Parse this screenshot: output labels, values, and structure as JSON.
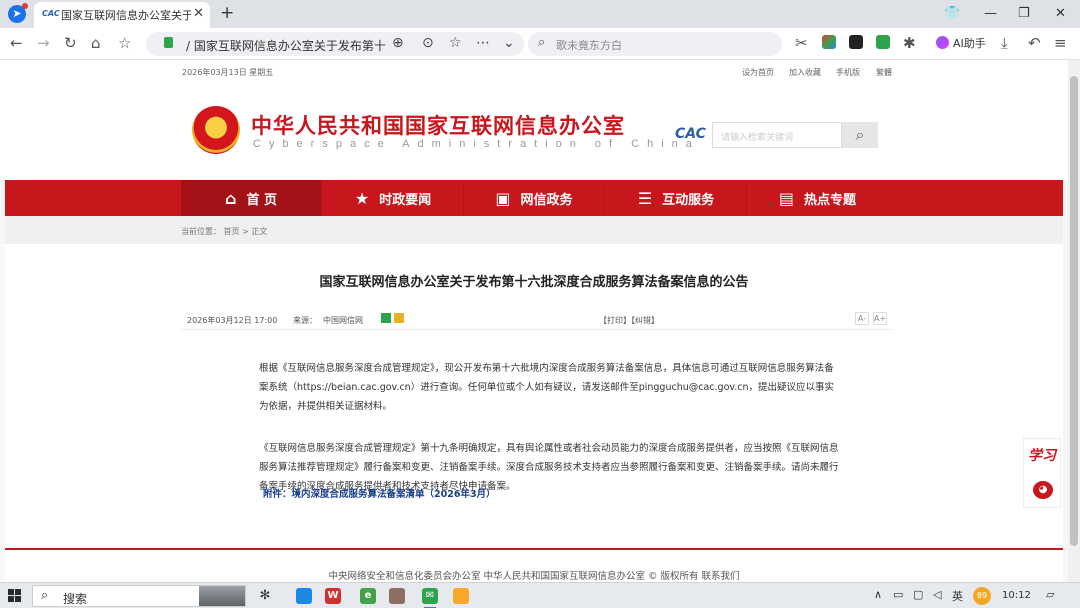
{
  "browser": {
    "tab_title": "国家互联网信息办公室关于发",
    "tab_favicon": "CAC",
    "address_text": "/ 国家互联网信息办公室关于发布第十",
    "search_placeholder": "歌未竟东方白",
    "ai_helper_label": "AI助手"
  },
  "page": {
    "top": {
      "date": "2026年03月13日 星期五",
      "links": [
        "设为首页",
        "加入收藏",
        "手机版",
        "繁體"
      ]
    },
    "header": {
      "title": "中华人民共和国国家互联网信息办公室",
      "subtitle": "Cyberspace Administration of China",
      "logo_text": "CAC",
      "search_placeholder": "请输入检索关键词"
    },
    "nav": [
      "首 页",
      "时政要闻",
      "网信政务",
      "互动服务",
      "热点专题"
    ],
    "breadcrumb": "当前位置： 首页 > 正文",
    "article": {
      "title": "国家互联网信息办公室关于发布第十六批深度合成服务算法备案信息的公告",
      "date": "2026年03月12日 17:00",
      "source_label": "来源：",
      "source": "中国网信网",
      "print_links": "【打印】【纠错】",
      "font_small": "A-",
      "font_large": "A+",
      "paragraphs": [
        "根据《互联网信息服务深度合成管理规定》，现公开发布第十六批境内深度合成服务算法备案信息，具体信息可通过互联网信息服务算法备案系统（https://beian.cac.gov.cn）进行查询。任何单位或个人如有疑议，请发送邮件至pingguchu@cac.gov.cn，提出疑议应以事实为依据，并提供相关证据材料。",
        "《互联网信息服务深度合成管理规定》第十九条明确规定，具有舆论属性或者社会动员能力的深度合成服务提供者，应当按照《互联网信息服务算法推荐管理规定》履行备案和变更、注销备案手续。深度合成服务技术支持者应当参照履行备案和变更、注销备案手续。请尚未履行备案手续的深度合成服务提供者和技术支持者尽快申请备案。"
      ],
      "attachment": "附件：境内深度合成服务算法备案清单（2026年3月）"
    },
    "footer": "中央网络安全和信息化委员会办公室  中华人民共和国国家互联网信息办公室 © 版权所有  联系我们",
    "float_widget": {
      "xuexi": "学习",
      "weixin_icon": "weixin-icon"
    }
  },
  "taskbar": {
    "search_text": "搜索",
    "ime": "英",
    "badge": "89",
    "time": "10:12"
  },
  "colors": {
    "brand_red": "#c8161d",
    "nav_active": "#a41217",
    "link_blue": "#1a3e8c"
  }
}
